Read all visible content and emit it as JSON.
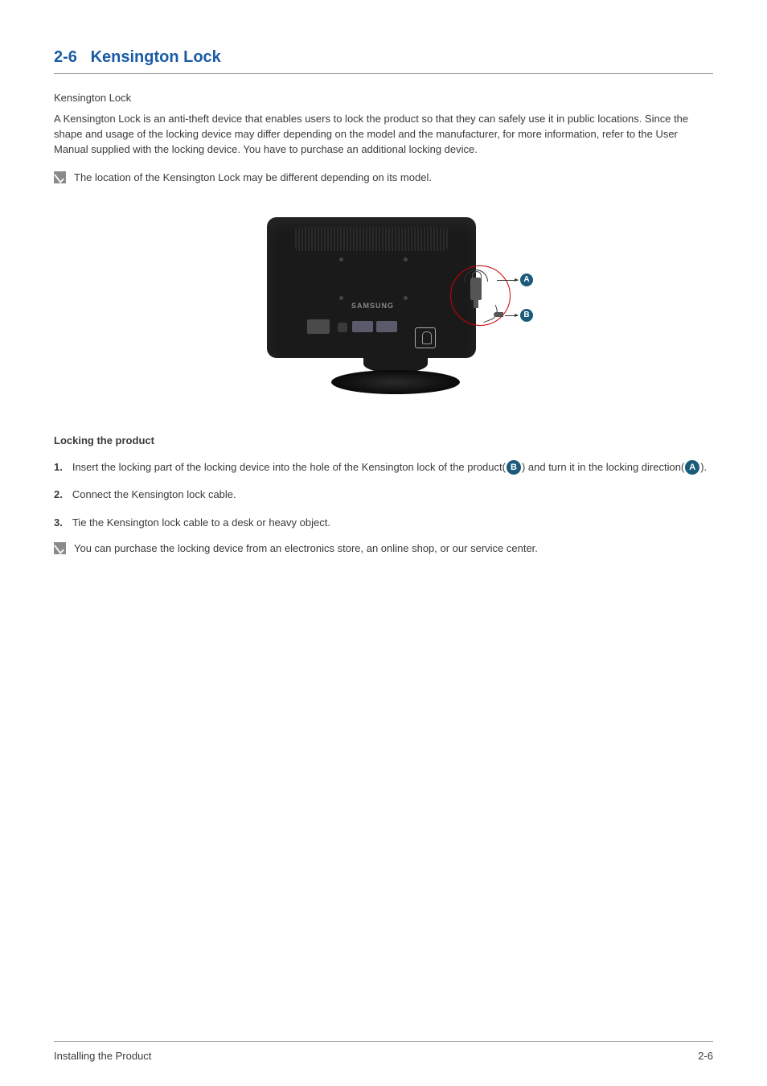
{
  "heading": {
    "number": "2-6",
    "title": "Kensington Lock"
  },
  "subtitle": "Kensington Lock",
  "intro_paragraph": "A Kensington Lock is an anti-theft device that enables users to lock the product so that they can safely use it in public locations. Since the shape and usage of the locking device may differ depending on the model and the manufacturer, for more information, refer to the User Manual supplied with the locking device. You have to purchase an additional locking device.",
  "note1": "The location of the Kensington Lock may be different depending on its model.",
  "figure": {
    "brand": "SAMSUNG",
    "label_a": "A",
    "label_b": "B"
  },
  "locking_section": {
    "title": "Locking the product",
    "steps": [
      {
        "num": "1.",
        "pre_text": "Insert the locking part of the locking device into the hole of the Kensington lock of the product(",
        "badge1": "B",
        "mid_text": ") and turn it in the locking direction(",
        "badge2": "A",
        "post_text": ")."
      },
      {
        "num": "2.",
        "text": "Connect the Kensington lock cable."
      },
      {
        "num": "3.",
        "text": "Tie the Kensington lock cable to a desk or heavy object."
      }
    ]
  },
  "note2": "You can purchase the locking device from an electronics store, an online shop, or our service center.",
  "footer": {
    "left": "Installing the Product",
    "right": "2-6"
  }
}
